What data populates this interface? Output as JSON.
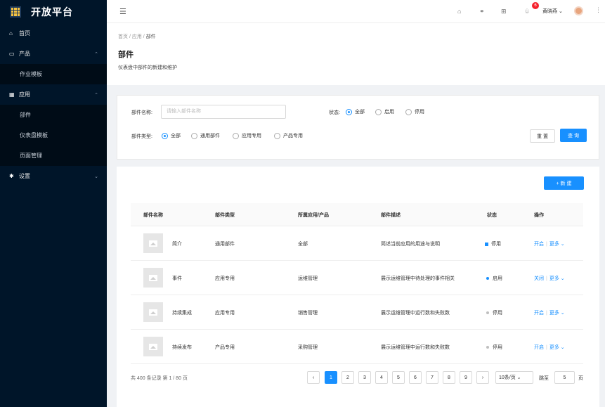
{
  "app": {
    "title": "开放平台"
  },
  "sidebar": {
    "items": [
      {
        "label": "首页",
        "icon": "home-icon"
      },
      {
        "label": "产品",
        "icon": "monitor-icon",
        "children": [
          "作业模板"
        ]
      },
      {
        "label": "应用",
        "icon": "calendar-icon",
        "children": [
          "部件",
          "仪表盘模板",
          "页面管理"
        ]
      },
      {
        "label": "设置",
        "icon": "gear-icon"
      }
    ]
  },
  "header": {
    "notification_count": "6",
    "user_name": "黄晓燕"
  },
  "breadcrumb": [
    "首页",
    "应用",
    "部件"
  ],
  "page": {
    "title": "部件",
    "description": "仪表盘中部件的新建和维护"
  },
  "filter": {
    "name_label": "部件名称:",
    "name_placeholder": "请输入部件名称",
    "status_label": "状态:",
    "status_options": [
      "全部",
      "启用",
      "停用"
    ],
    "status_selected": "全部",
    "type_label": "部件类型:",
    "type_options": [
      "全部",
      "通用部件",
      "应用专用",
      "产品专用"
    ],
    "type_selected": "全部",
    "reset_label": "重 置",
    "query_label": "查 询"
  },
  "table": {
    "new_label": "+ 新 建",
    "columns": [
      "部件名称",
      "部件类型",
      "所属应用/产品",
      "部件描述",
      "状态",
      "操作"
    ],
    "rows": [
      {
        "name": "简介",
        "type": "通用部件",
        "belongs": "全部",
        "desc": "简述当前应用的用途与说明",
        "status": "停用",
        "op1": "开启",
        "op2": "更多"
      },
      {
        "name": "事件",
        "type": "应用专用",
        "belongs": "运维管理",
        "desc": "展示运维管理中待处理的事件相关",
        "status": "启用",
        "op1": "关闭",
        "op2": "更多"
      },
      {
        "name": "持续集成",
        "type": "应用专用",
        "belongs": "销售管理",
        "desc": "展示运维管理中运行数和失败数",
        "status": "停用",
        "op1": "开启",
        "op2": "更多"
      },
      {
        "name": "持续发布",
        "type": "产品专用",
        "belongs": "采购管理",
        "desc": "展示运维管理中运行数和失败数",
        "status": "停用",
        "op1": "开启",
        "op2": "更多"
      }
    ]
  },
  "pagination": {
    "total_text": "共 400 条记录 第 1 / 80 页",
    "pages": [
      "1",
      "2",
      "3",
      "4",
      "5",
      "6",
      "7",
      "8",
      "9"
    ],
    "current": "1",
    "page_size": "10条/页",
    "jump_label": "跳至",
    "jump_value": "5",
    "page_suffix": "页"
  },
  "colors": {
    "primary": "#1890ff",
    "sidebar_bg": "#001529",
    "badge": "#f5222d"
  }
}
